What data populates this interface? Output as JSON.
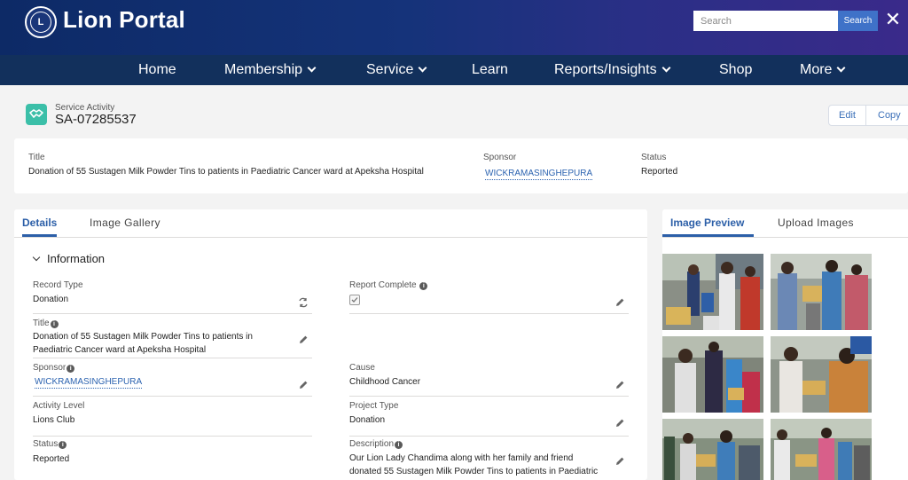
{
  "header": {
    "brand": "Lion Portal",
    "search_placeholder": "Search",
    "search_button": "Search",
    "close_glyph": "✕"
  },
  "nav": {
    "items": [
      {
        "label": "Home",
        "dropdown": false
      },
      {
        "label": "Membership",
        "dropdown": true
      },
      {
        "label": "Service",
        "dropdown": true
      },
      {
        "label": "Learn",
        "dropdown": false
      },
      {
        "label": "Reports/Insights",
        "dropdown": true
      },
      {
        "label": "Shop",
        "dropdown": false
      },
      {
        "label": "More",
        "dropdown": true
      }
    ]
  },
  "record": {
    "object_type": "Service Activity",
    "name": "SA-07285537",
    "edit_label": "Edit",
    "copy_label": "Copy",
    "icon": "handshake-icon"
  },
  "highlights": {
    "title_label": "Title",
    "title_value": "Donation of 55 Sustagen Milk Powder Tins to patients in Paediatric Cancer ward at Apeksha Hospital",
    "sponsor_label": "Sponsor",
    "sponsor_value": "WICKRAMASINGHEPURA",
    "status_label": "Status",
    "status_value": "Reported"
  },
  "detail": {
    "tabs": [
      "Details",
      "Image Gallery"
    ],
    "section_title": "Information",
    "fields": {
      "record_type": {
        "label": "Record Type",
        "value": "Donation"
      },
      "report_complete": {
        "label": "Report Complete",
        "checked": true
      },
      "title": {
        "label": "Title",
        "value_line1": "Donation of 55 Sustagen Milk Powder Tins to patients in",
        "value_line2": "Paediatric Cancer ward at Apeksha Hospital"
      },
      "sponsor": {
        "label": "Sponsor",
        "value": "WICKRAMASINGHEPURA"
      },
      "cause": {
        "label": "Cause",
        "value": "Childhood Cancer"
      },
      "activity_level": {
        "label": "Activity Level",
        "value": "Lions Club"
      },
      "project_type": {
        "label": "Project Type",
        "value": "Donation"
      },
      "status": {
        "label": "Status",
        "value": "Reported"
      },
      "description": {
        "label": "Description",
        "value_line1": "Our Lion Lady Chandima along with her family and friend",
        "value_line2": "donated 55 Sustagen Milk Powder Tins to patients in Paediatric"
      }
    }
  },
  "images": {
    "tabs": [
      "Image Preview",
      "Upload Images"
    ],
    "count": 6
  },
  "colors": {
    "accent": "#2c5fa8",
    "nav_bg": "#12305c",
    "header_bg": "#15337a",
    "record_icon": "#3bbfa8",
    "search_button": "#3f72c8"
  }
}
